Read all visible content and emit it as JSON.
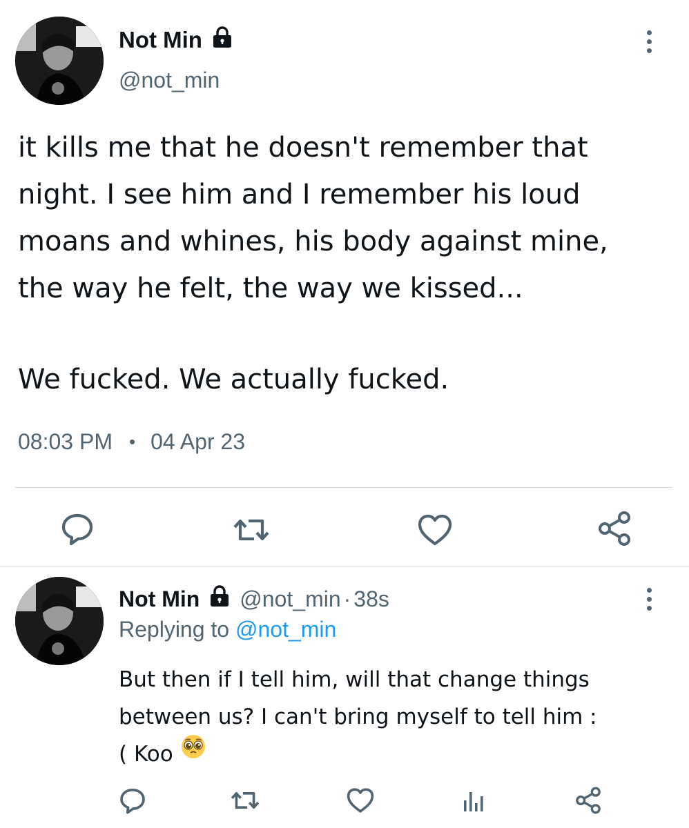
{
  "tweet": {
    "author_name": "Not Min",
    "handle": "@not_min",
    "text_lines": [
      "it kills me that he doesn't remember that",
      "night. I see him and I remember his loud",
      "moans and whines, his body against mine,",
      "the way he felt, the way we kissed..."
    ],
    "text_line_2": "We fucked. We actually fucked.",
    "time": "08:03 PM",
    "separator": "•",
    "date": "04 Apr 23",
    "icons": {
      "reply": "reply-icon",
      "retweet": "retweet-icon",
      "like": "like-icon",
      "share": "share-icon",
      "lock": "lock-icon",
      "more": "more-options-icon"
    }
  },
  "reply": {
    "author_name": "Not Min",
    "handle": "@not_min",
    "separator": "·",
    "time": "38s",
    "replying_prefix": "Replying to",
    "replying_mention": "@not_min",
    "text_lines": [
      "But then if I tell him, will that change things",
      "between us? I can't bring myself to tell him :",
      "( Koo"
    ],
    "emoji": "pleading-face-emoji",
    "icons": {
      "reply": "reply-icon",
      "retweet": "retweet-icon",
      "like": "like-icon",
      "analytics": "analytics-icon",
      "share": "share-icon"
    }
  },
  "colors": {
    "primary_text": "#0f1419",
    "secondary_text": "#536471",
    "link": "#1d9bf0",
    "divider": "#d8dde1"
  }
}
